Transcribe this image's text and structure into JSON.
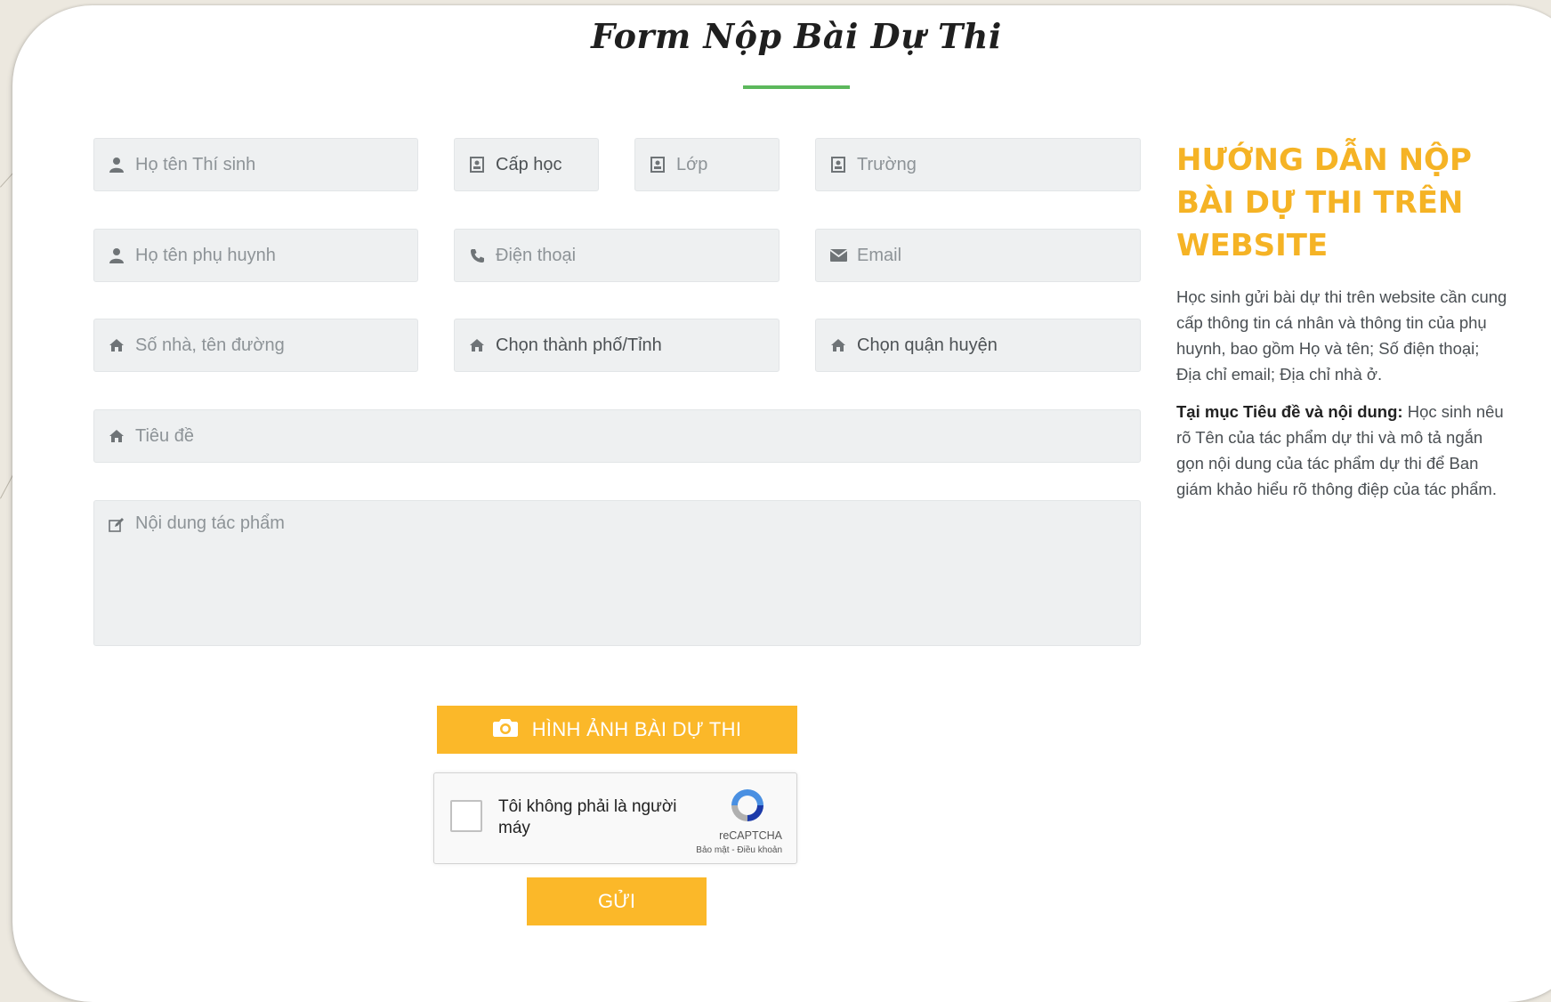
{
  "form": {
    "title": "Form Nộp Bài Dự Thi",
    "fields": {
      "student_name": "Họ tên Thí sinh",
      "level": "Cấp học",
      "class": "Lớp",
      "school": "Trường",
      "parent_name": "Họ tên phụ huynh",
      "phone": "Điện thoại",
      "email": "Email",
      "address": "Số nhà, tên đường",
      "city": "Chọn thành phố/Tỉnh",
      "district": "Chọn quận huyện",
      "subject": "Tiêu đề",
      "content": "Nội dung tác phẩm"
    },
    "upload_label": "HÌNH ẢNH BÀI DỰ THI",
    "captcha": {
      "label": "Tôi không phải là người máy",
      "brand": "reCAPTCHA",
      "links": "Bảo mật - Điều khoản"
    },
    "submit_label": "GỬI"
  },
  "guide": {
    "title": "HƯỚNG DẪN NỘP BÀI DỰ THI TRÊN WEBSITE",
    "paragraph1": "Học sinh gửi bài dự thi trên website cần cung cấp thông tin cá nhân và thông tin của phụ huynh, bao gồm Họ và tên; Số điện thoại; Địa chỉ email; Địa chỉ nhà ở.",
    "paragraph2_bold": "Tại mục Tiêu đề và nội dung:",
    "paragraph2_text": " Học sinh nêu rõ Tên của tác phẩm dự thi và mô tả ngắn gọn nội dung của tác phẩm dự thi để Ban giám khảo hiểu rõ thông điệp của tác phẩm."
  },
  "colors": {
    "accent": "#fbb829",
    "heading": "#f5b325",
    "underline": "#5cb85c",
    "field_bg": "#eef0f1"
  },
  "icons": {
    "student_name": "user-icon",
    "level": "id-card-icon",
    "class": "id-card-icon",
    "school": "id-card-icon",
    "parent_name": "user-icon",
    "phone": "phone-icon",
    "email": "envelope-icon",
    "address": "home-icon",
    "city": "home-icon",
    "district": "home-icon",
    "subject": "home-icon",
    "content": "edit-icon",
    "upload": "camera-icon",
    "captcha": "recaptcha-logo"
  }
}
